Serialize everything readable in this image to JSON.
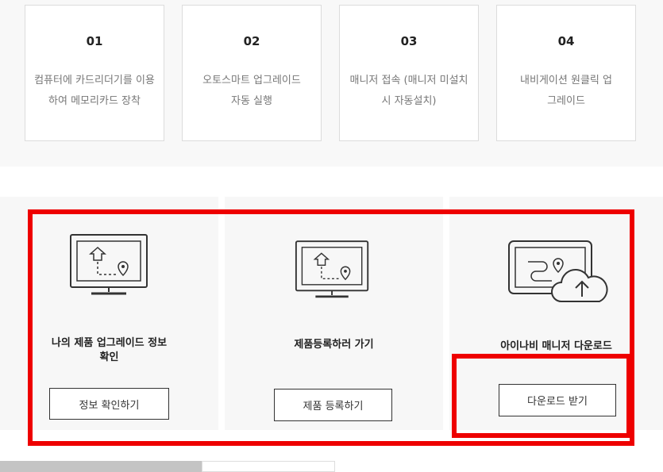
{
  "steps": [
    {
      "num": "01",
      "desc": "컴퓨터에 카드리더기를 이용하여 메모리카드 장착"
    },
    {
      "num": "02",
      "desc": "오토스마트 업그레이드 자동 실행"
    },
    {
      "num": "03",
      "desc": "매니저 접속 (매니저 미설치 시 자동설치)"
    },
    {
      "num": "04",
      "desc": "내비게이션 원클릭 업그레이드"
    }
  ],
  "actions": [
    {
      "label": "나의 제품 업그레이드 정보 확인",
      "button": "정보 확인하기",
      "icon": "monitor-route-icon"
    },
    {
      "label": "제품등록하러 가기",
      "button": "제품 등록하기",
      "icon": "monitor-route-icon"
    },
    {
      "label": "아이나비 매니저 다운로드",
      "button": "다운로드 받기",
      "icon": "device-cloud-upload-icon"
    }
  ],
  "colors": {
    "highlight": "#ee0000",
    "panel_bg": "#f7f7f7",
    "band_bg": "#f8f8f8"
  }
}
